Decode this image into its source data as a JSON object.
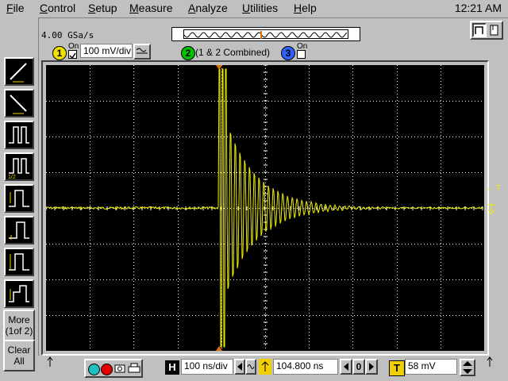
{
  "menu": {
    "items": [
      "File",
      "Control",
      "Setup",
      "Measure",
      "Analyze",
      "Utilities",
      "Help"
    ],
    "underline": [
      "F",
      "C",
      "S",
      "M",
      "A",
      "U",
      "H"
    ],
    "clock": "12:21 AM"
  },
  "status": {
    "sample_rate": "4.00 GSa/s"
  },
  "channels": {
    "ch1": {
      "number": "1",
      "on_label": "On",
      "checked": true,
      "scale": "100 mV/div"
    },
    "ch2": {
      "number": "2",
      "label": "(1 & 2 Combined)"
    },
    "ch3": {
      "number": "3",
      "on_label": "On",
      "checked": false
    }
  },
  "sidebar": {
    "more": "More (1of 2)",
    "clear_all": "Clear All",
    "tools": [
      "rising-edge-trigger-icon",
      "falling-edge-trigger-icon",
      "pulse-width-icon",
      "pulse-width-1of2-icon",
      "timing-delta-icon",
      "timing-up-icon",
      "timing-updown-icon",
      "timing-stair-icon"
    ]
  },
  "screen": {
    "trigger_marker": "← T",
    "trace_color": "#f0f000",
    "grid_color": "#ffffff"
  },
  "bottom": {
    "h_label": "H",
    "timebase": "100 ns/div",
    "delay": "104.800 ns",
    "zero_label": "0",
    "t_label": "T",
    "trigger_level": "58 mV"
  }
}
